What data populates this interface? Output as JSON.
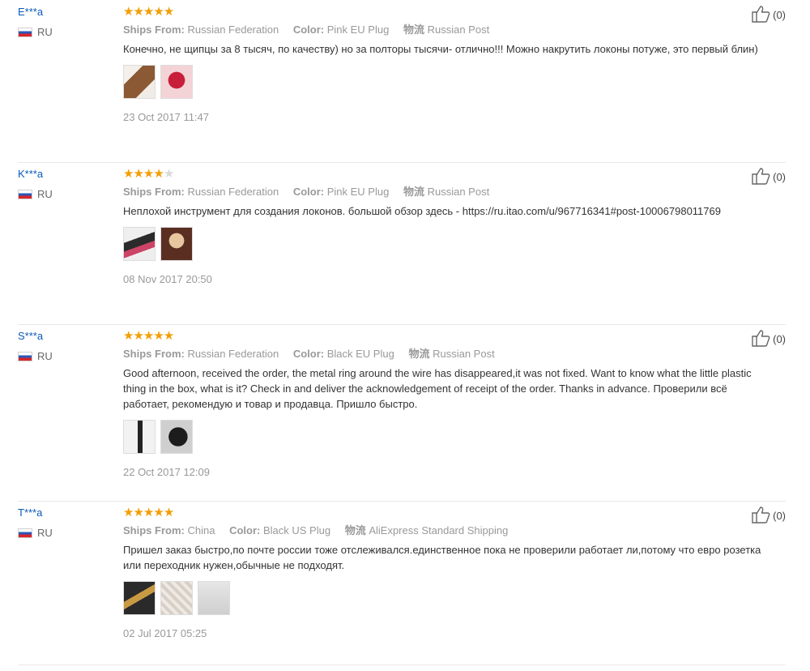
{
  "reviews": [
    {
      "user": "E***a",
      "country": "RU",
      "rating": 5,
      "ships_from_label": "Ships From:",
      "ships_from": "Russian Federation",
      "color_label": "Color:",
      "color": "Pink EU Plug",
      "logistics_label": "物流",
      "logistics": "Russian Post",
      "text": "Конечно, не щипцы за 8 тысяч, по качеству) но за полторы тысячи- отлично!!! Можно накрутить локоны потуже, это первый блин)",
      "photos": [
        "photo-hair",
        "photo-device-pink"
      ],
      "date": "23 Oct 2017 11:47",
      "helpful": "(0)"
    },
    {
      "user": "K***a",
      "country": "RU",
      "rating": 4,
      "ships_from_label": "Ships From:",
      "ships_from": "Russian Federation",
      "color_label": "Color:",
      "color": "Pink EU Plug",
      "logistics_label": "物流",
      "logistics": "Russian Post",
      "text": "Неплохой инструмент для создания локонов. большой обзор здесь - https://ru.itao.com/u/967716341#post-10006798011769",
      "photos": [
        "photo-device-kit",
        "photo-hair-curls"
      ],
      "date": "08 Nov 2017 20:50",
      "helpful": "(0)"
    },
    {
      "user": "S***a",
      "country": "RU",
      "rating": 5,
      "ships_from_label": "Ships From:",
      "ships_from": "Russian Federation",
      "color_label": "Color:",
      "color": "Black EU Plug",
      "logistics_label": "物流",
      "logistics": "Russian Post",
      "text": "Good afternoon, received the order, the metal ring around the wire has disappeared,it was not fixed. Want to know what the little plastic thing in the box, what is it? Check in and deliver the acknowledgement of receipt of the order. Thanks in advance. Проверили всё работает, рекомендую и товар и продавца. Пришло быстро.",
      "photos": [
        "photo-plastic-part",
        "photo-device-black"
      ],
      "date": "22 Oct 2017 12:09",
      "helpful": "(0)"
    },
    {
      "user": "T***a",
      "country": "RU",
      "rating": 5,
      "ships_from_label": "Ships From:",
      "ships_from": "China",
      "color_label": "Color:",
      "color": "Black US Plug",
      "logistics_label": "物流",
      "logistics": "AliExpress Standard Shipping",
      "text": "Пришел заказ быстро,по почте россии тоже отслеживался.единственное пока не проверили работает ли,потому что евро розетка или переходник нужен,обычные не подходят.",
      "photos": [
        "photo-device-gold",
        "photo-package",
        "photo-package-2"
      ],
      "date": "02 Jul 2017 05:25",
      "helpful": "(0)"
    }
  ],
  "colors": {
    "username": "#0a5ab8",
    "star": "#f29f05",
    "star_empty": "#d9d9d9"
  }
}
